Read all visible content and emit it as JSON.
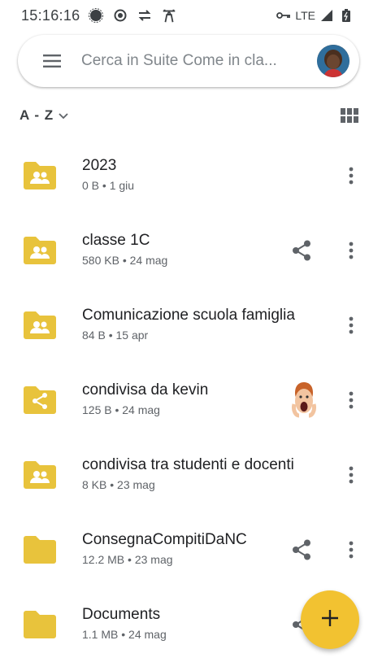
{
  "status_bar": {
    "time": "15:16:16",
    "network": "LTE",
    "icons": [
      "signal-app-icon",
      "recording-icon",
      "data-saver-icon",
      "accessibility-icon",
      "vpn-key-icon",
      "cellular-signal-icon",
      "battery-icon"
    ]
  },
  "search": {
    "placeholder": "Cerca in Suite Come in cla...",
    "menu_icon": "hamburger-menu-icon",
    "avatar_icon": "account-avatar"
  },
  "sort": {
    "label": "A - Z",
    "view_toggle_icon": "grid-view-icon"
  },
  "colors": {
    "folder": "#e8c33c",
    "folder_shared_symbol": "#ffffff",
    "fab": "#f2c231",
    "icon_gray": "#5f6368"
  },
  "files": [
    {
      "name": "2023",
      "meta": "0 B • 1 giu",
      "icon": "shared-drive-folder-icon",
      "trailing": "none"
    },
    {
      "name": "classe 1C",
      "meta": "580 KB • 24 mag",
      "icon": "shared-drive-folder-icon",
      "trailing": "share-icon"
    },
    {
      "name": "Comunicazione scuola famiglia",
      "meta": "84 B • 15 apr",
      "icon": "shared-drive-folder-icon",
      "trailing": "none"
    },
    {
      "name": "condivisa da kevin",
      "meta": "125 B • 24 mag",
      "icon": "shared-folder-icon",
      "trailing": "owner-avatar"
    },
    {
      "name": "condivisa tra studenti e docenti",
      "meta": "8 KB • 23 mag",
      "icon": "shared-drive-folder-icon",
      "trailing": "none"
    },
    {
      "name": "ConsegnaCompitiDaNC",
      "meta": "12.2 MB • 23 mag",
      "icon": "folder-icon",
      "trailing": "share-icon"
    },
    {
      "name": "Documents",
      "meta": "1.1 MB • 24 mag",
      "icon": "folder-icon",
      "trailing": "share-icon"
    }
  ],
  "fab": {
    "label": "+",
    "icon": "plus-icon"
  }
}
